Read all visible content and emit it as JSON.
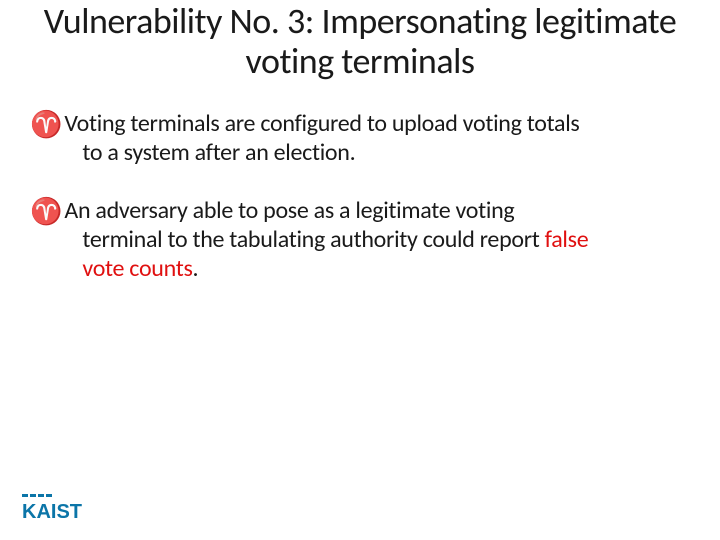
{
  "title": "Vulnerability No. 3: Impersonating legitimate voting terminals",
  "bullets": [
    {
      "line1": "Voting terminals are configured to upload voting totals",
      "line2": "to a system after an election."
    },
    {
      "line1": "An adversary able to pose as a legitimate voting",
      "line2_pre": "terminal to the tabulating authority could report ",
      "line2_emph": "false",
      "line3_emph": "vote counts",
      "line3_post": "."
    }
  ],
  "logo_text": "KAIST",
  "colors": {
    "accent": "#e01010",
    "logo_blue": "#0b75a8"
  }
}
